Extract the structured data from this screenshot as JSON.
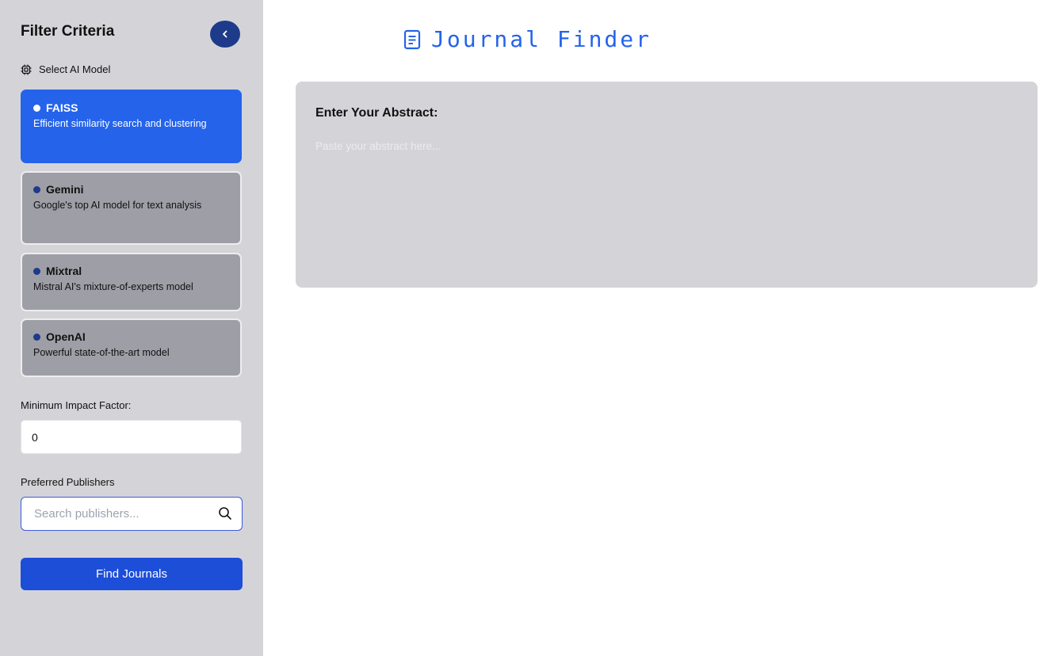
{
  "sidebar": {
    "title": "Filter Criteria",
    "collapse_icon": "chevron-left-icon",
    "model_heading": "Select AI Model",
    "model_heading_icon": "cpu-chip-icon",
    "models": [
      {
        "name": "FAISS",
        "description": "Efficient similarity search and clustering",
        "selected": true
      },
      {
        "name": "Gemini",
        "description": "Google's top AI model for text analysis",
        "selected": false
      },
      {
        "name": "Mixtral",
        "description": "Mistral AI's mixture-of-experts model",
        "selected": false
      },
      {
        "name": "OpenAI",
        "description": "Powerful state-of-the-art model",
        "selected": false
      }
    ],
    "impact_label": "Minimum Impact Factor:",
    "impact_value": "0",
    "publishers_label": "Preferred Publishers",
    "publishers_placeholder": "Search publishers...",
    "publishers_icon": "search-icon",
    "find_button": "Find Journals"
  },
  "main": {
    "title": "Journal Finder",
    "title_icon": "document-icon",
    "abstract_label": "Enter Your Abstract:",
    "abstract_placeholder": "Paste your abstract here..."
  },
  "colors": {
    "accent": "#2563eb",
    "button": "#1d4ed8",
    "sidebar_bg": "#d4d4d8",
    "card_bg": "#9e9ea6",
    "dot": "#1e3a8a"
  }
}
